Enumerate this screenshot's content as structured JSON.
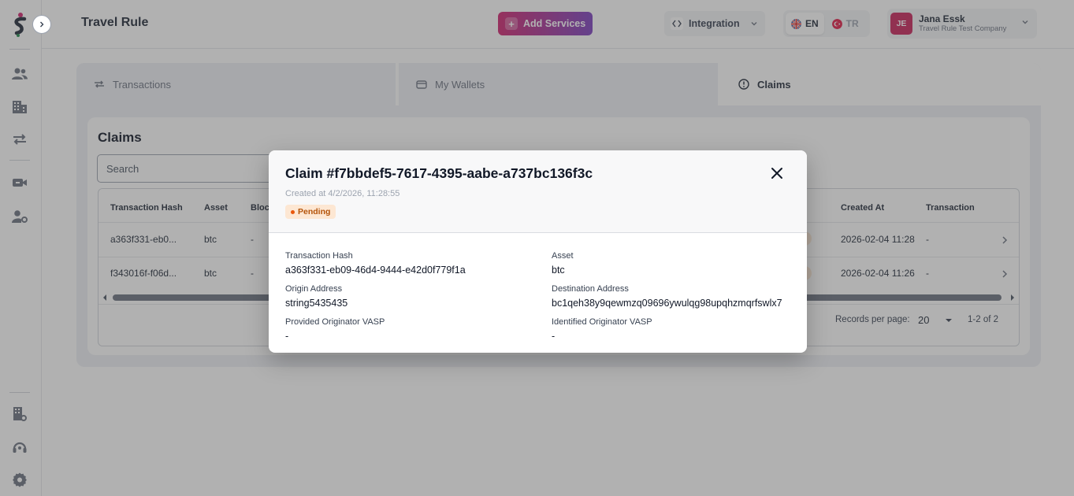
{
  "header": {
    "title": "Travel Rule",
    "add_services_label": "Add Services",
    "integration_label": "Integration",
    "languages": [
      {
        "code": "EN",
        "active": true
      },
      {
        "code": "TR",
        "active": false
      }
    ],
    "user": {
      "initials": "JE",
      "name": "Jana Essk",
      "company": "Travel Rule Test Company"
    }
  },
  "tabs": [
    {
      "label": "Transactions",
      "icon": "arrows-exchange-icon"
    },
    {
      "label": "My Wallets",
      "icon": "wallet-icon"
    },
    {
      "label": "Claims",
      "icon": "alert-circle-icon",
      "active": true
    }
  ],
  "claims_page": {
    "title": "Claims",
    "search_placeholder": "Search",
    "columns": [
      "Transaction Hash",
      "Asset",
      "Bloc",
      "Created At",
      "Transaction"
    ],
    "rows": [
      {
        "hash": "a363f331-eb0...",
        "asset": "btc",
        "block": "-",
        "created_at": "2026-02-04 11:28",
        "transaction": "-"
      },
      {
        "hash": "f343016f-f06d...",
        "asset": "btc",
        "block": "-",
        "created_at": "2026-02-04 11:26",
        "transaction": "-"
      }
    ],
    "records_per_page_label": "Records per page:",
    "records_per_page_value": "20",
    "range_label": "1-2 of 2"
  },
  "modal": {
    "title": "Claim #f7bbdef5-7617-4395-aabe-a737bc136f3c",
    "created": "Created at 4/2/2026, 11:28:55",
    "status": "Pending",
    "fields": {
      "tx_hash_label": "Transaction Hash",
      "tx_hash_value": "a363f331-eb09-46d4-9444-e42d0f779f1a",
      "asset_label": "Asset",
      "asset_value": "btc",
      "origin_label": "Origin Address",
      "origin_value": "string5435435",
      "destination_label": "Destination Address",
      "destination_value": "bc1qeh38y9qewmzq09696ywulqg98upqhzmqrfswlx7",
      "provided_vasp_label": "Provided Originator VASP",
      "provided_vasp_value": "-",
      "identified_vasp_label": "Identified Originator VASP",
      "identified_vasp_value": "-"
    }
  },
  "colors": {
    "brand_gradient_start": "#d0246f",
    "brand_gradient_end": "#7b3fbf",
    "avatar_bg": "#c8245b",
    "pending_bg": "#fde7d3",
    "pending_text": "#b45309"
  }
}
